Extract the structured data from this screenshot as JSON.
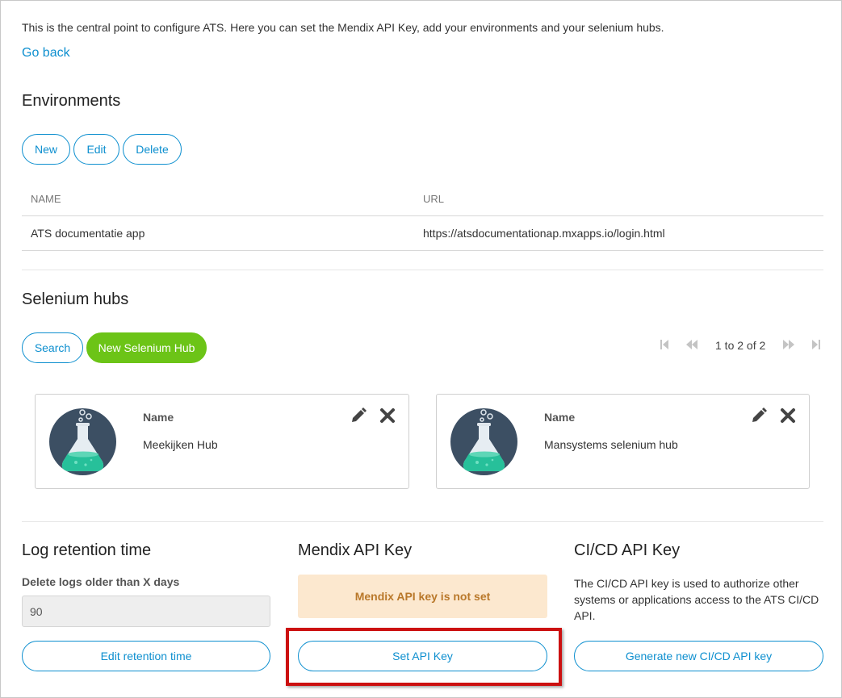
{
  "intro": "This is the central point to configure ATS. Here you can set the Mendix API Key, add your environments and your selenium hubs.",
  "go_back": "Go back",
  "environments": {
    "title": "Environments",
    "buttons": {
      "new": "New",
      "edit": "Edit",
      "delete": "Delete"
    },
    "columns": [
      "NAME",
      "URL"
    ],
    "rows": [
      {
        "name": "ATS documentatie app",
        "url": "https://atsdocumentationap.mxapps.io/login.html"
      }
    ]
  },
  "selenium_hubs": {
    "title": "Selenium hubs",
    "search_label": "Search",
    "new_label": "New Selenium Hub",
    "pager": {
      "text": "1 to 2 of 2",
      "first_icon": "first-page-icon",
      "prev_icon": "prev-page-icon",
      "next_icon": "next-page-icon",
      "last_icon": "last-page-icon"
    },
    "cards": [
      {
        "label": "Name",
        "value": "Meekijken Hub"
      },
      {
        "label": "Name",
        "value": "Mansystems selenium hub"
      }
    ]
  },
  "log_retention": {
    "title": "Log retention time",
    "field_label": "Delete logs older than X days",
    "value": "90",
    "button": "Edit retention time"
  },
  "mendix_api": {
    "title": "Mendix API Key",
    "alert": "Mendix API key is not set",
    "button": "Set API Key"
  },
  "cicd_api": {
    "title": "CI/CD API Key",
    "description": "The CI/CD API key is used to authorize other systems or applications access to the ATS CI/CD API.",
    "button": "Generate new CI/CD API key"
  },
  "colors": {
    "accent": "#0d8fcf",
    "green": "#6cc417",
    "warning_bg": "#fce8cf",
    "warning_text": "#b9782a",
    "highlight": "#cc1111"
  }
}
